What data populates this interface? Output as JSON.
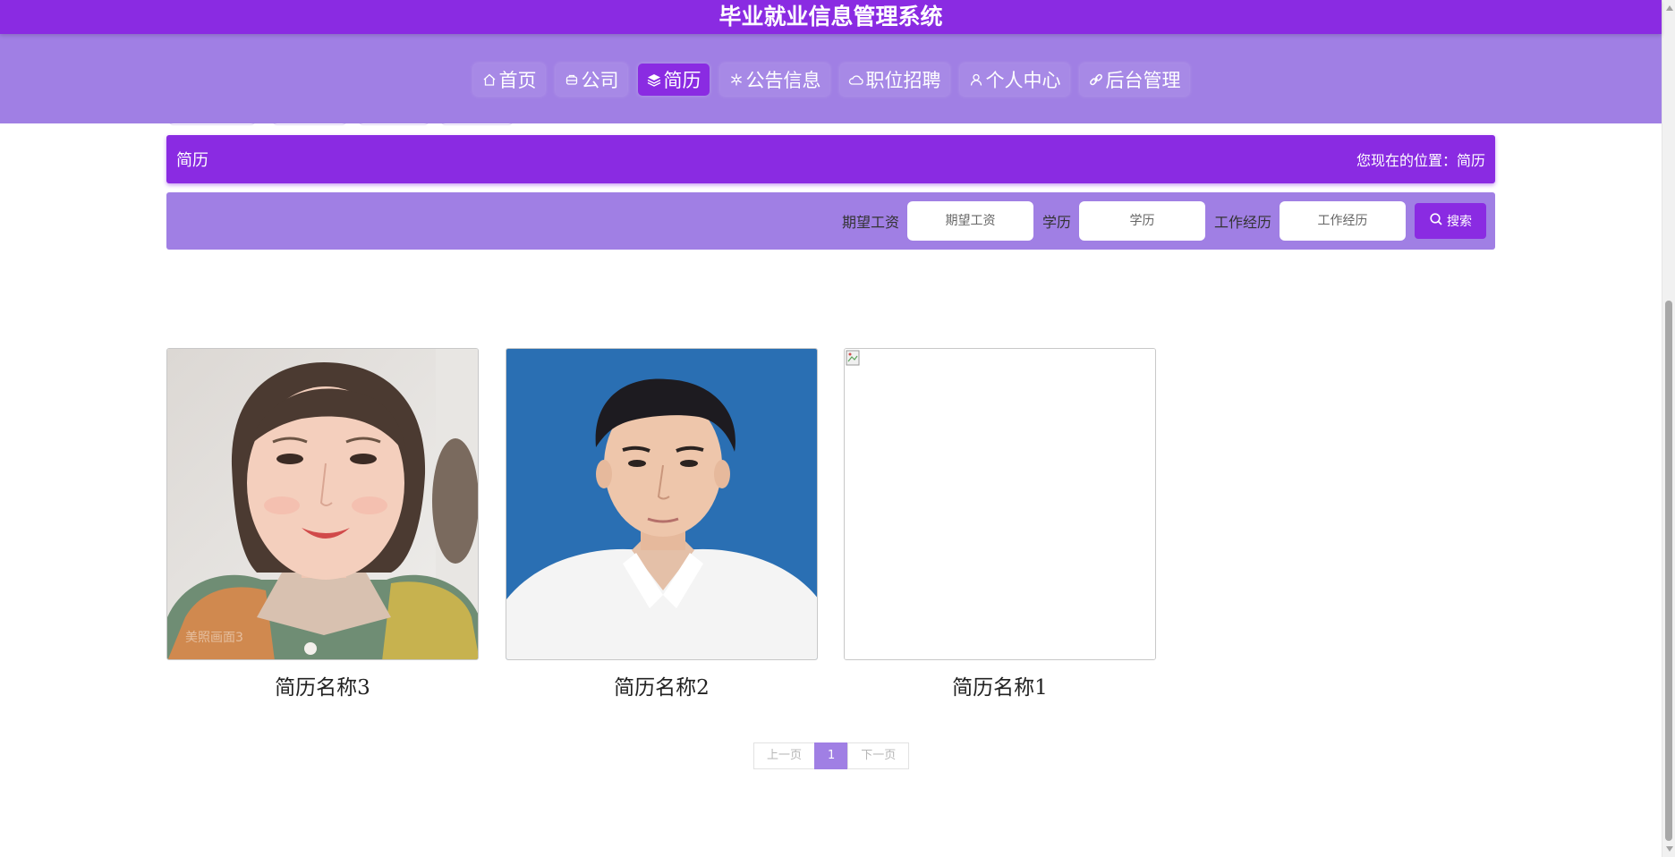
{
  "header": {
    "title": "毕业就业信息管理系统"
  },
  "nav": {
    "items": [
      {
        "label": "首页",
        "icon": "home-icon"
      },
      {
        "label": "公司",
        "icon": "company-icon"
      },
      {
        "label": "简历",
        "icon": "layers-icon",
        "active": true
      },
      {
        "label": "公告信息",
        "icon": "snowflake-icon"
      },
      {
        "label": "职位招聘",
        "icon": "cloud-icon"
      },
      {
        "label": "个人中心",
        "icon": "user-icon"
      },
      {
        "label": "后台管理",
        "icon": "link-icon"
      }
    ]
  },
  "titlebar": {
    "title": "简历",
    "location": "您现在的位置：简历"
  },
  "search": {
    "salary_label": "期望工资",
    "salary_placeholder": "期望工资",
    "education_label": "学历",
    "education_placeholder": "学历",
    "experience_label": "工作经历",
    "experience_placeholder": "工作经历",
    "button_label": "搜索"
  },
  "cards": [
    {
      "name": "简历名称3"
    },
    {
      "name": "简历名称2"
    },
    {
      "name": "简历名称1"
    }
  ],
  "watermark": "美照画面3",
  "pagination": {
    "prev": "上一页",
    "current": "1",
    "next": "下一页"
  },
  "colors": {
    "primary": "#8a2be2",
    "secondary": "#a07fe4"
  }
}
